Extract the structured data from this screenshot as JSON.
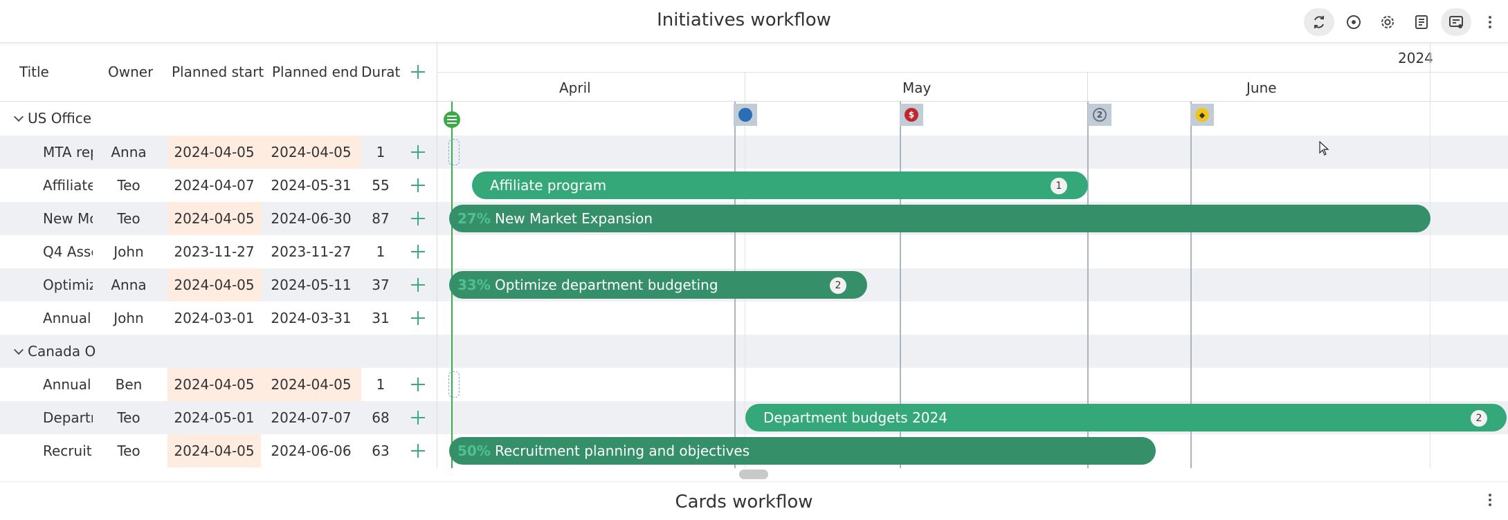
{
  "header": {
    "title": "Initiatives workflow"
  },
  "toolbar": {
    "icons": [
      "refresh-icon",
      "target-icon",
      "gear-icon",
      "notes-icon",
      "card-settings-icon",
      "kebab-menu-icon"
    ]
  },
  "grid": {
    "columns": [
      "Title",
      "Owner",
      "Planned start",
      "Planned end",
      "Durati"
    ],
    "groups": [
      {
        "name": "US Office",
        "rows": [
          {
            "title": "MTA rep",
            "owner": "Anna",
            "start": "2024-04-05",
            "end": "2024-04-05",
            "duration": "1"
          },
          {
            "title": "Affiliate",
            "owner": "Teo",
            "start": "2024-04-07",
            "end": "2024-05-31",
            "duration": "55"
          },
          {
            "title": "New Mc",
            "owner": "Teo",
            "start": "2024-04-05",
            "end": "2024-06-30",
            "duration": "87"
          },
          {
            "title": "Q4 Asse",
            "owner": "John",
            "start": "2023-11-27",
            "end": "2023-11-27",
            "duration": "1"
          },
          {
            "title": "Optimiz",
            "owner": "Anna",
            "start": "2024-04-05",
            "end": "2024-05-11",
            "duration": "37"
          },
          {
            "title": "Annual",
            "owner": "John",
            "start": "2024-03-01",
            "end": "2024-03-31",
            "duration": "31"
          }
        ]
      },
      {
        "name": "Canada O",
        "rows": [
          {
            "title": "Annual",
            "owner": "Ben",
            "start": "2024-04-05",
            "end": "2024-04-05",
            "duration": "1"
          },
          {
            "title": "Departr",
            "owner": "Teo",
            "start": "2024-05-01",
            "end": "2024-07-07",
            "duration": "68"
          },
          {
            "title": "Recruitr",
            "owner": "Teo",
            "start": "2024-04-05",
            "end": "2024-06-06",
            "duration": "63"
          }
        ]
      }
    ]
  },
  "timeline": {
    "year": "2024",
    "months": [
      "April",
      "May",
      "June"
    ],
    "milestones": [
      {
        "icon": "contrast-icon",
        "color": "#2a6fb5",
        "text": ""
      },
      {
        "icon": "dollar-icon",
        "color": "#c0282d",
        "text": "$"
      },
      {
        "icon": "number-2-icon",
        "color": "#8a96a3",
        "text": "2"
      },
      {
        "icon": "diamond-icon",
        "color": "#f0c419",
        "text": "◆"
      }
    ],
    "bars": [
      {
        "label": "Affiliate program",
        "badge": "1"
      },
      {
        "label": "New Market Expansion",
        "progress": "27%"
      },
      {
        "label": "Optimize department budgeting",
        "progress": "33%",
        "badge": "2"
      },
      {
        "label": "Department budgets 2024",
        "badge": "2"
      },
      {
        "label": "Recruitment planning and objectives",
        "progress": "50%"
      }
    ]
  },
  "footer": {
    "title": "Cards workflow"
  }
}
